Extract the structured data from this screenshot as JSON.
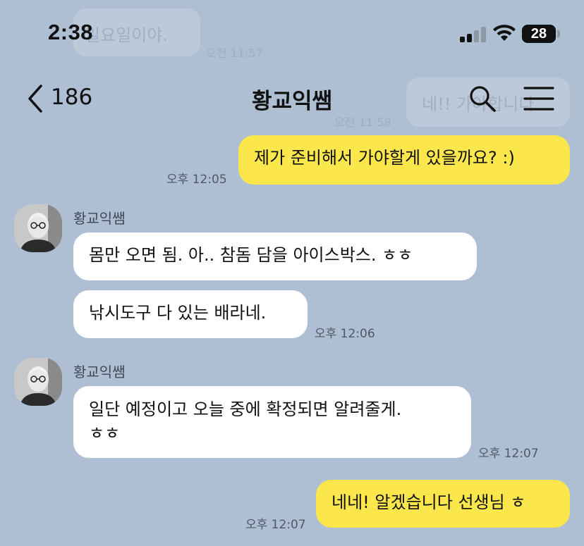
{
  "status_bar": {
    "time": "2:38",
    "battery": "28"
  },
  "header": {
    "back_count": "186",
    "title": "황교익쌤"
  },
  "background_messages": {
    "partial_1": "일요일이야.",
    "partial_1_time": "오전 11:57",
    "partial_2": "네!! 가야합니다",
    "partial_2_time": "오전 11:58"
  },
  "messages": [
    {
      "from": "me",
      "text": "제가 준비해서 가야할게 있을까요? :)",
      "time": "오후 12:05"
    },
    {
      "from": "other",
      "sender": "황교익쌤",
      "text": "몸만 오면 됨. 아.. 참돔 담을 아이스박스. ㅎㅎ"
    },
    {
      "from": "other",
      "text": "낚시도구 다 있는 배라네.",
      "time": "오후 12:06"
    },
    {
      "from": "other",
      "sender": "황교익쌤",
      "text_line1": "일단 예정이고 오늘 중에 확정되면 알려줄게.",
      "text_line2": "ㅎㅎ",
      "time": "오후 12:07"
    },
    {
      "from": "me",
      "text": "네네! 알겠습니다 선생님 ㅎ",
      "time": "오후 12:07"
    }
  ],
  "colors": {
    "background": "#aebfd3",
    "my_bubble": "#fbe74c",
    "other_bubble": "#ffffff"
  },
  "icons": {
    "back": "chevron-left-icon",
    "search": "search-icon",
    "menu": "hamburger-menu-icon"
  }
}
